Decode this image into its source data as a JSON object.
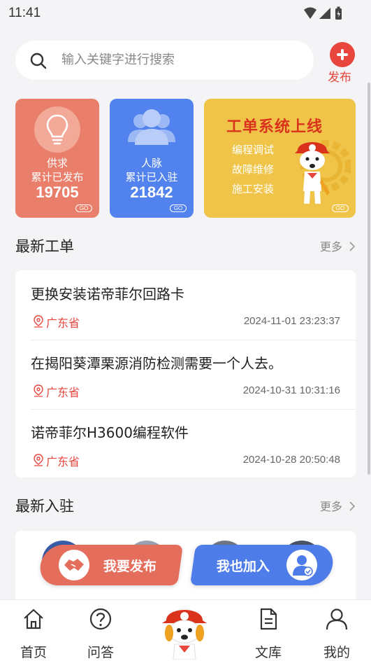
{
  "status_bar": {
    "time": "11:41",
    "icons": [
      "wifi-icon",
      "signal-icon",
      "battery-icon"
    ]
  },
  "search": {
    "placeholder": "输入关键字进行搜索"
  },
  "header": {
    "publish_label": "发布"
  },
  "stats_cards": [
    {
      "icon": "lightbulb-icon",
      "title": "供求",
      "subtitle": "累计已发布",
      "count": "19705",
      "badge": "GO",
      "color": "#e97f6a"
    },
    {
      "icon": "people-icon",
      "title": "人脉",
      "subtitle": "累计已入驻",
      "count": "21842",
      "badge": "GO",
      "color": "#5282ed"
    }
  ],
  "banner": {
    "title": "工单系统上线",
    "lines": [
      "编程调试",
      "故障维修",
      "施工安装"
    ],
    "badge": "GO",
    "color": "#f0c448"
  },
  "latest_orders": {
    "title": "最新工单",
    "more": "更多",
    "items": [
      {
        "title": "更换安装诺帝菲尔回路卡",
        "location": "广东省",
        "time": "2024-11-01 23:23:37"
      },
      {
        "title": "在揭阳葵潭栗源消防检测需要一个人去。",
        "location": "广东省",
        "time": "2024-10-31 10:31:16"
      },
      {
        "title": "诺帝菲尔H3600编程软件",
        "location": "广东省",
        "time": "2024-10-28 20:50:48"
      }
    ]
  },
  "latest_members": {
    "title": "最新入驻",
    "more": "更多"
  },
  "cta": {
    "publish": "我要发布",
    "join": "我也加入"
  },
  "tab_bar": {
    "items": [
      {
        "label": "首页",
        "icon": "home-icon"
      },
      {
        "label": "问答",
        "icon": "question-icon"
      },
      {
        "label": "文库",
        "icon": "document-icon"
      },
      {
        "label": "我的",
        "icon": "profile-icon"
      }
    ],
    "center_icon": "mascot-icon"
  },
  "colors": {
    "accent_red": "#e8453c",
    "accent_blue": "#4e7de9"
  }
}
